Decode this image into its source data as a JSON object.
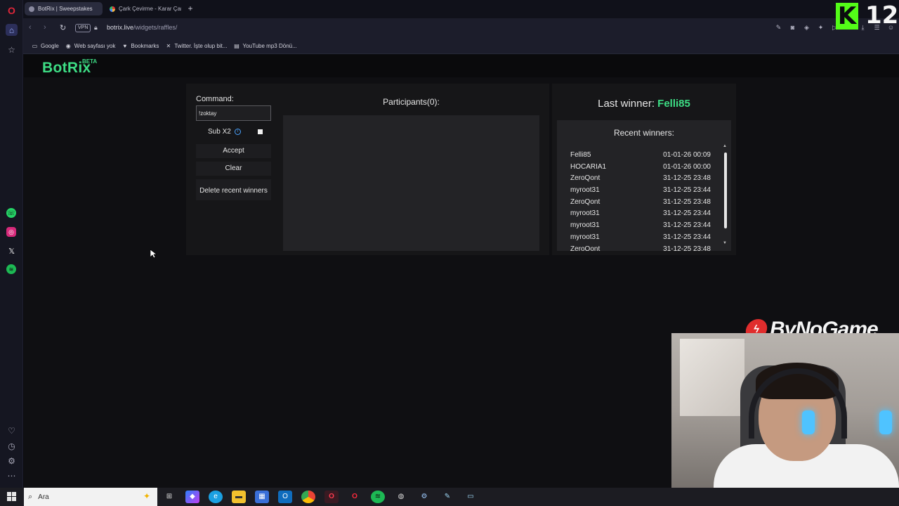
{
  "browser": {
    "tabs": [
      {
        "label": "BotRix | Sweepstakes",
        "active": true
      },
      {
        "label": "Çark Çevirme - Karar Çark",
        "active": false
      }
    ],
    "new_tab": "+",
    "vpn_label": "VPN",
    "url_host": "botrix.live",
    "url_path": "/widgets/raffles/",
    "bookmarks": [
      {
        "label": "Google",
        "icon": "google-icon"
      },
      {
        "label": "Web sayfası yok",
        "icon": "chrome-icon"
      },
      {
        "label": "Bookmarks",
        "icon": "heart-icon"
      },
      {
        "label": "Twitter. İşte olup bit...",
        "icon": "x-icon"
      },
      {
        "label": "YouTube mp3 Dönü...",
        "icon": "page-icon"
      }
    ]
  },
  "botrix": {
    "logo": "BotRix",
    "beta": "BETA",
    "accent": "#3ddc84"
  },
  "raffle": {
    "command_label": "Command:",
    "command_value": "!zoktay",
    "sub_label": "Sub X2",
    "sub_checked": false,
    "accept_label": "Accept",
    "clear_label": "Clear",
    "delete_label": "Delete recent winners",
    "participants_label": "Participants(0):"
  },
  "winners": {
    "last_winner_label": "Last winner: ",
    "last_winner_name": "Felli85",
    "recent_title": "Recent winners:",
    "list": [
      {
        "name": "Felli85",
        "time": "01-01-26 00:09"
      },
      {
        "name": "HOCARIA1",
        "time": "01-01-26 00:00"
      },
      {
        "name": "ZeroQont",
        "time": "31-12-25 23:48"
      },
      {
        "name": "myroot31",
        "time": "31-12-25 23:44"
      },
      {
        "name": "ZeroQont",
        "time": "31-12-25 23:48"
      },
      {
        "name": "myroot31",
        "time": "31-12-25 23:44"
      },
      {
        "name": "myroot31",
        "time": "31-12-25 23:44"
      },
      {
        "name": "myroot31",
        "time": "31-12-25 23:44"
      },
      {
        "name": "ZeroQont",
        "time": "31-12-25 23:48"
      }
    ]
  },
  "overlay": {
    "kick_letter": "K",
    "kick_count": "12",
    "sponsor": "ByNoGame"
  },
  "taskbar": {
    "search_placeholder": "Ara"
  }
}
